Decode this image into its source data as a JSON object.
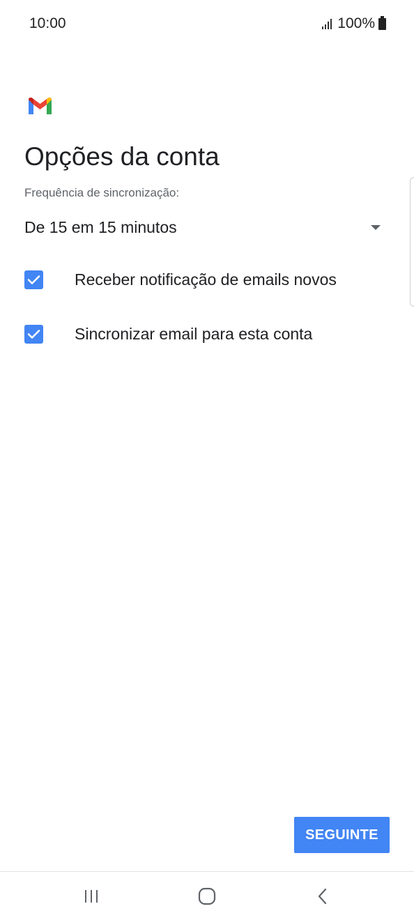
{
  "status_bar": {
    "time": "10:00",
    "battery": "100%"
  },
  "header": {
    "logo_icon": "gmail-logo-icon",
    "title": "Opções da conta"
  },
  "sync": {
    "label": "Frequência de sincronização:",
    "selected": "De 15 em 15 minutos"
  },
  "options": [
    {
      "label": "Receber notificação de emails novos",
      "checked": true
    },
    {
      "label": "Sincronizar email para esta conta",
      "checked": true
    }
  ],
  "actions": {
    "next_label": "SEGUINTE"
  },
  "colors": {
    "accent": "#4285f4",
    "gmail_red": "#ea4335",
    "gmail_blue": "#4285f4",
    "gmail_green": "#34a853",
    "gmail_yellow": "#fbbc04"
  },
  "nav_icons": [
    "recents-icon",
    "home-icon",
    "back-icon"
  ]
}
